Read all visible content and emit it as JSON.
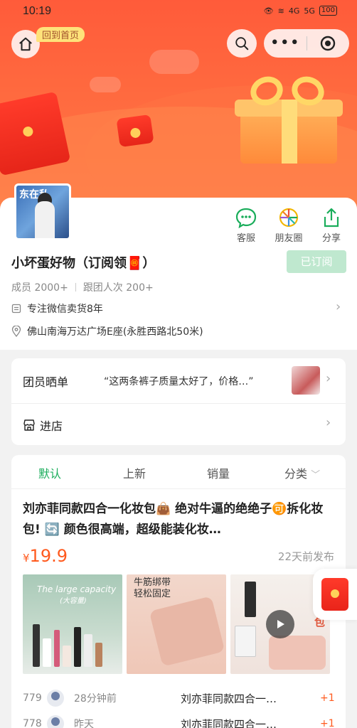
{
  "status_bar": {
    "time": "10:19",
    "signal": "4G",
    "signal2": "5G",
    "battery": "100"
  },
  "nav": {
    "home_tag": "回到首页"
  },
  "profile": {
    "avatar_text": "东在私",
    "shop_name": "小坏蛋好物（订阅领🧧）",
    "subscribe_label": "已订阅",
    "members": "成员 2000+",
    "follow_count": "跟团人次 200+",
    "description": "专注微信卖货8年",
    "address": "佛山南海万达广场E座(永胜西路北50米)"
  },
  "actions": [
    {
      "label": "客服",
      "icon": "chat-icon"
    },
    {
      "label": "朋友圈",
      "icon": "moments-icon"
    },
    {
      "label": "分享",
      "icon": "share-icon"
    }
  ],
  "reviews": {
    "title": "团员晒单",
    "quote": "“这两条裤子质量太好了，价格…”",
    "store_label": "进店"
  },
  "tabs": [
    "默认",
    "上新",
    "销量",
    "分类"
  ],
  "post": {
    "title": "刘亦菲同款四合一化妆包👜 绝对牛逼的绝绝子🉑拆化妆包! 🔄 颜色很高端，超级能装化妆…",
    "price_currency": "¥",
    "price": "19.9",
    "posted": "22天前发布",
    "image1_caption": "The large capacity",
    "image1_caption2": "(大容量)",
    "image2_caption": "牛筋绑带\n轻松固定",
    "image3_caption": "叠化妆包"
  },
  "orders": [
    {
      "num": "779",
      "when": "28分钟前",
      "product": "刘亦菲同款四合一…",
      "qty": "+1"
    },
    {
      "num": "778",
      "when": "昨天",
      "product": "刘亦菲同款四合一…",
      "qty": "+1"
    }
  ],
  "colors": {
    "accent_green": "#1aad5b",
    "price_orange": "#ff5a1e",
    "hero_red": "#ff5b3a"
  }
}
